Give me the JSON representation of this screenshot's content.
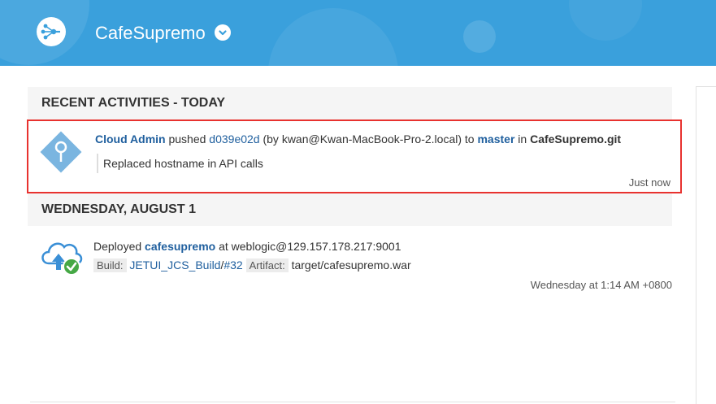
{
  "header": {
    "project_name": "CafeSupremo",
    "brand_color": "#3aa0dc"
  },
  "recent": {
    "title": "RECENT ACTIVITIES - TODAY",
    "activity": {
      "user": "Cloud Admin",
      "verb": "pushed",
      "commit": "d039e02d",
      "by": "(by kwan@Kwan-MacBook-Pro-2.local) to",
      "branch": "master",
      "in": "in",
      "repo": "CafeSupremo.git",
      "message": "Replaced hostname in API calls",
      "time": "Just now",
      "icon": "git-push-icon"
    }
  },
  "wednesday": {
    "title": "WEDNESDAY, AUGUST 1",
    "activity": {
      "prefix": "Deployed",
      "app": "cafesupremo",
      "target": "at weblogic@129.157.178.217:9001",
      "build_label": "Build:",
      "build_job": "JETUI_JCS_Build",
      "build_sep": "/",
      "build_num": "#32",
      "artifact_label": "Artifact:",
      "artifact": "target/cafesupremo.war",
      "time": "Wednesday at 1:14 AM +0800",
      "icon": "cloud-deploy-success-icon"
    }
  },
  "colors": {
    "highlight_border": "#e8322f",
    "link": "#1f5f9e",
    "success": "#45a845"
  }
}
